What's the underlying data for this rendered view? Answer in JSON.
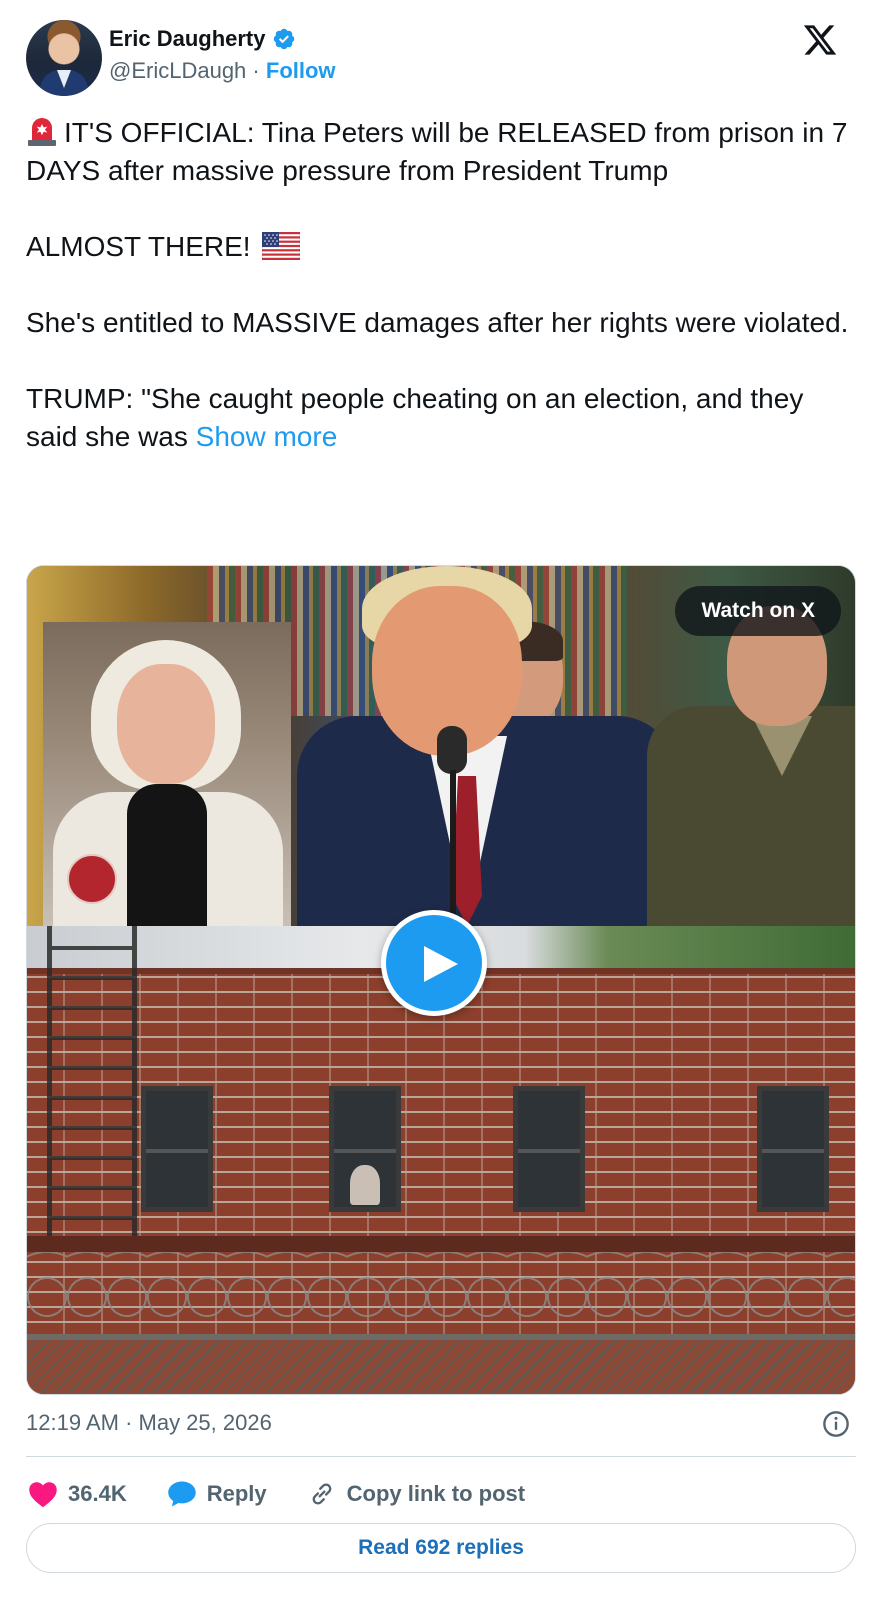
{
  "author": {
    "name": "Eric Daugherty",
    "handle": "@EricLDaugh",
    "separator": "·",
    "follow_label": "Follow",
    "verified_color": "#1d9bf0"
  },
  "tweet": {
    "line1": "IT'S OFFICIAL: Tina Peters will be RELEASED from prison in 7 DAYS after massive pressure from President Trump",
    "line2": "ALMOST THERE!",
    "line3": "She's entitled to MASSIVE damages after her rights were violated.",
    "line4": "TRUMP: \"She caught people cheating on an election, and they said she was",
    "show_more": "Show more",
    "emoji_siren": "siren-icon",
    "emoji_flag": "us-flag-icon"
  },
  "media": {
    "watch_label": "Watch on X",
    "play_icon": "play-icon"
  },
  "meta": {
    "timestamp": "12:19 AM · May 25, 2026"
  },
  "actions": {
    "likes": "36.4K",
    "reply_label": "Reply",
    "copy_label": "Copy link to post"
  },
  "read_replies": "Read 692 replies",
  "colors": {
    "accent": "#1d9bf0",
    "like": "#f91880",
    "text": "#0f1419",
    "muted": "#536471"
  }
}
